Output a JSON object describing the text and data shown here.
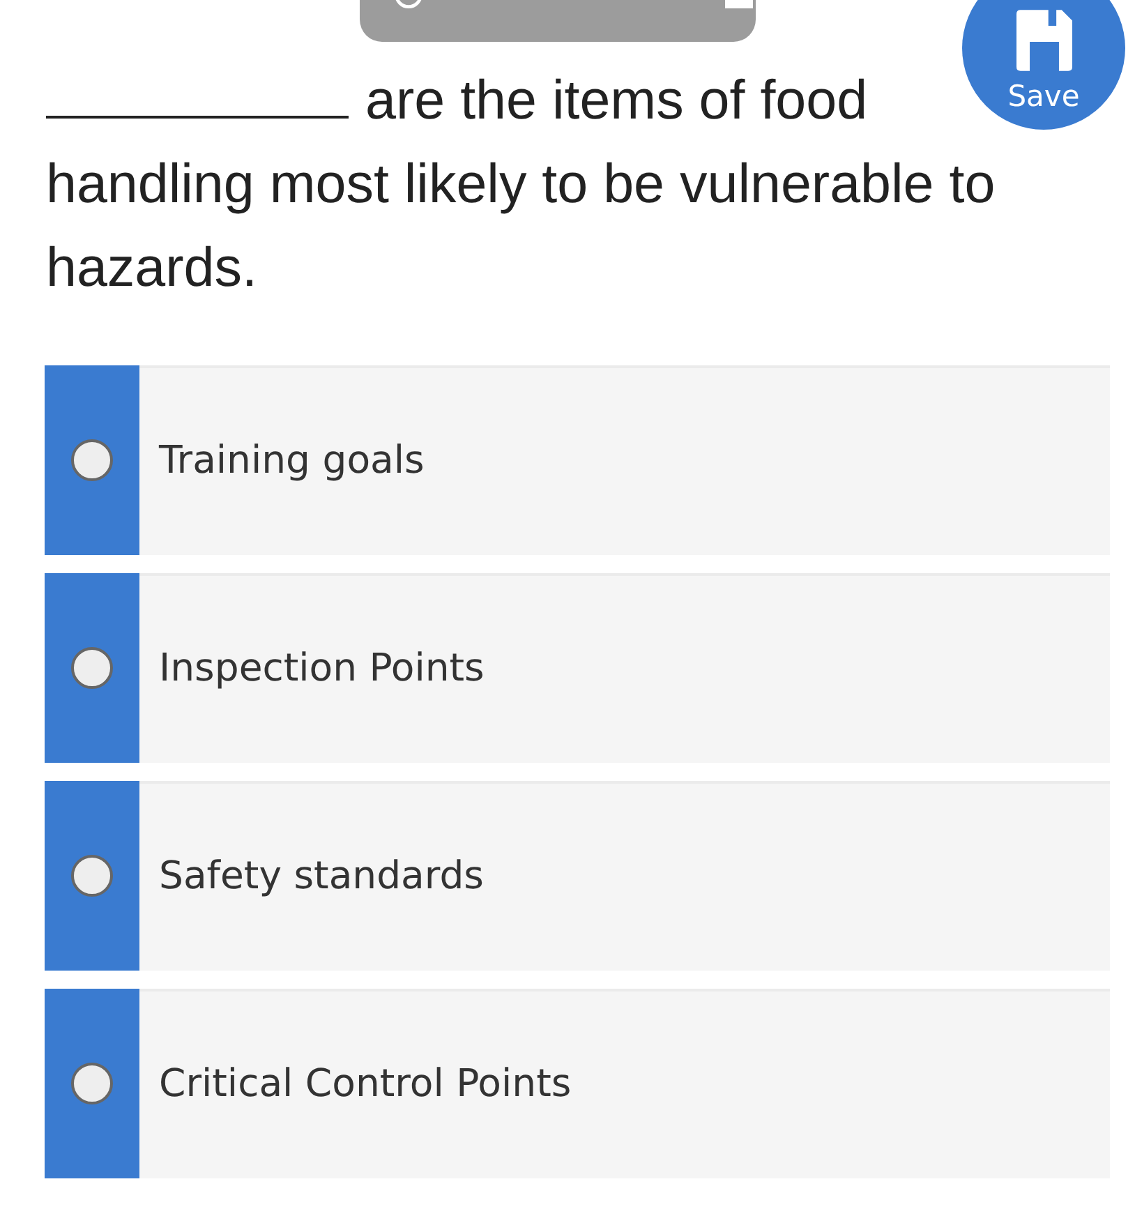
{
  "save_button": {
    "label": "Save"
  },
  "question": {
    "text": "are the items of food handling most likely to be vulnerable to hazards."
  },
  "options": [
    {
      "label": "Training goals",
      "selected": false
    },
    {
      "label": "Inspection Points",
      "selected": false
    },
    {
      "label": "Safety standards",
      "selected": false
    },
    {
      "label": "Critical Control Points",
      "selected": false
    }
  ]
}
